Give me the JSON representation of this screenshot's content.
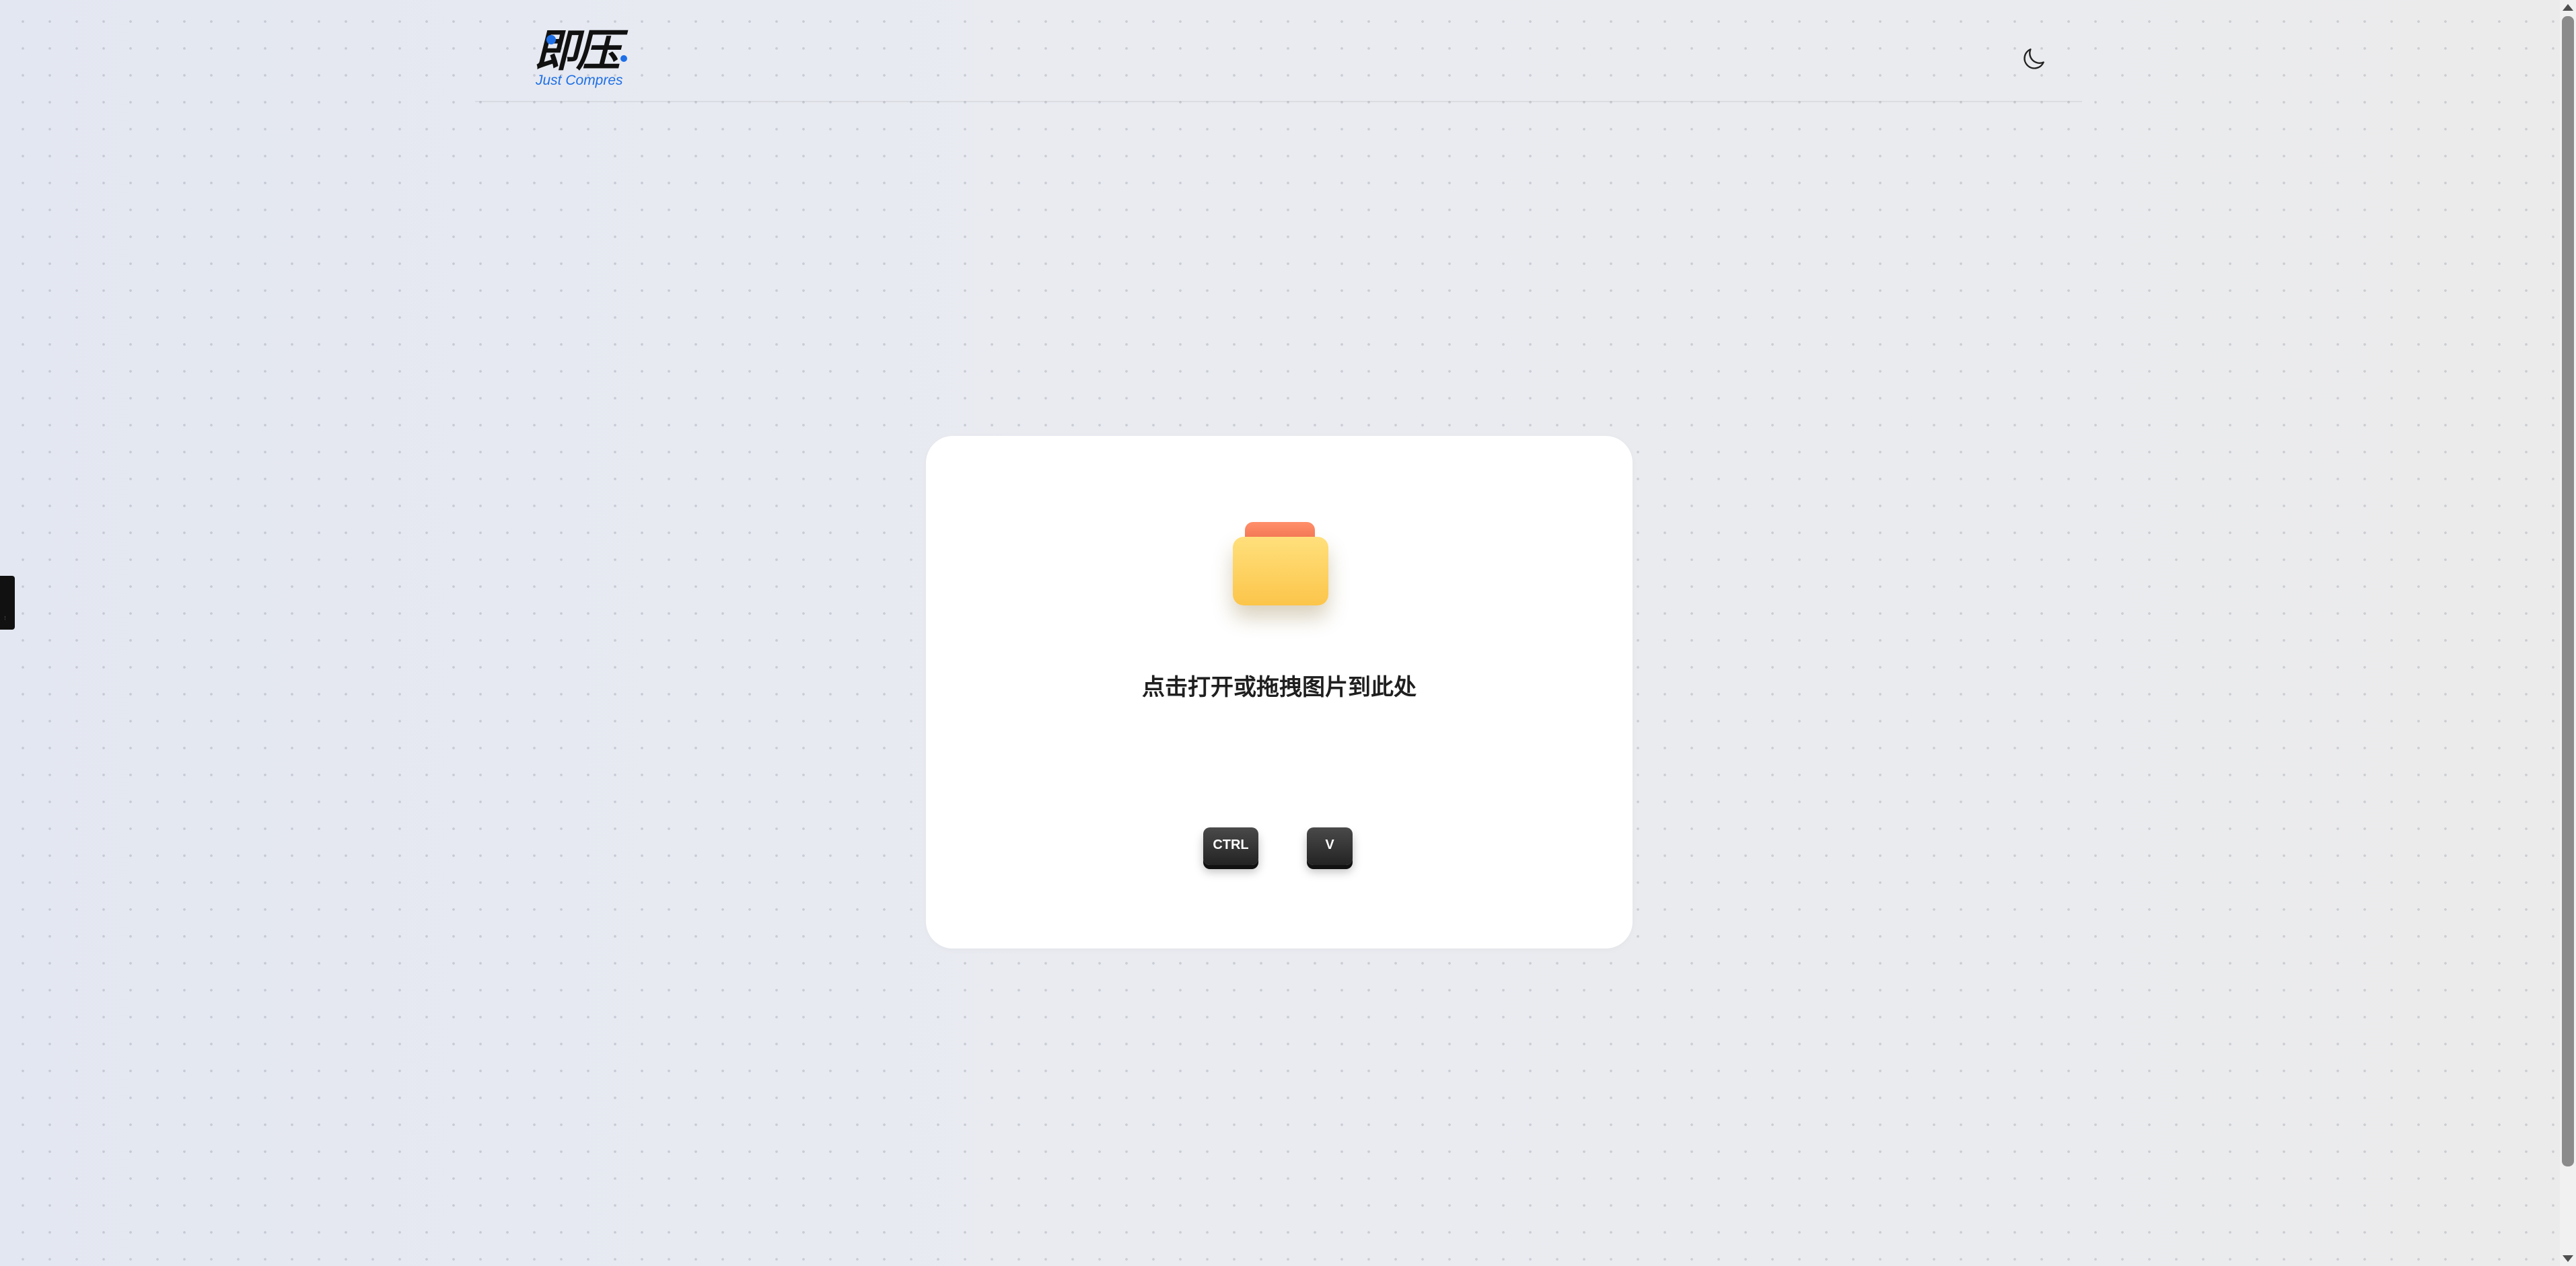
{
  "header": {
    "logo": {
      "mark": "即压",
      "subtitle": "Just Compres"
    },
    "theme_toggle_icon": "moon-icon"
  },
  "side_tab": {
    "label": "···"
  },
  "upload": {
    "icon": "folder-icon",
    "prompt": "点击打开或拖拽图片到此处",
    "shortcut_keys": [
      "CTRL",
      "V"
    ]
  },
  "colors": {
    "brand_blue": "#1e6fe6",
    "folder_yellow": "#fcc54a",
    "folder_tab": "#f06a4a",
    "key_dark": "#2a2a2a"
  }
}
